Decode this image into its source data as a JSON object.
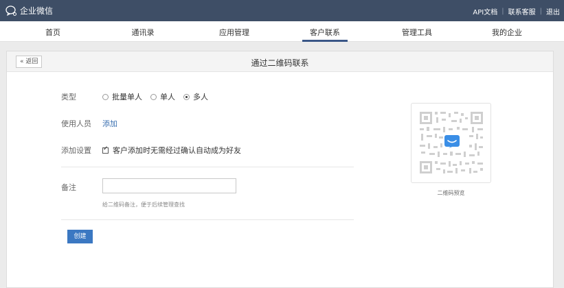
{
  "header": {
    "app_title": "企业微信",
    "links": [
      "API文档",
      "联系客服",
      "退出"
    ]
  },
  "nav": {
    "items": [
      "首页",
      "通讯录",
      "应用管理",
      "客户联系",
      "管理工具",
      "我的企业"
    ],
    "active": "客户联系"
  },
  "panel": {
    "back_label": "« 返回",
    "title": "通过二维码联系"
  },
  "form": {
    "type_label": "类型",
    "type_options": [
      "批量单人",
      "单人",
      "多人"
    ],
    "type_selected": "多人",
    "users_label": "使用人员",
    "users_add": "添加",
    "settings_label": "添加设置",
    "settings_checkbox": "客户添加时无需经过确认自动成为好友",
    "settings_checked": true,
    "note_label": "备注",
    "note_value": "",
    "note_placeholder": "",
    "note_hint": "给二维码备注，便于后续管理查找",
    "create_label": "创建"
  },
  "qr_preview": {
    "caption": "二维码预览"
  },
  "colors": {
    "topbar": "#3e4e66",
    "accent": "#3a5687",
    "button": "#3b78c2",
    "link": "#3a6fb0"
  }
}
